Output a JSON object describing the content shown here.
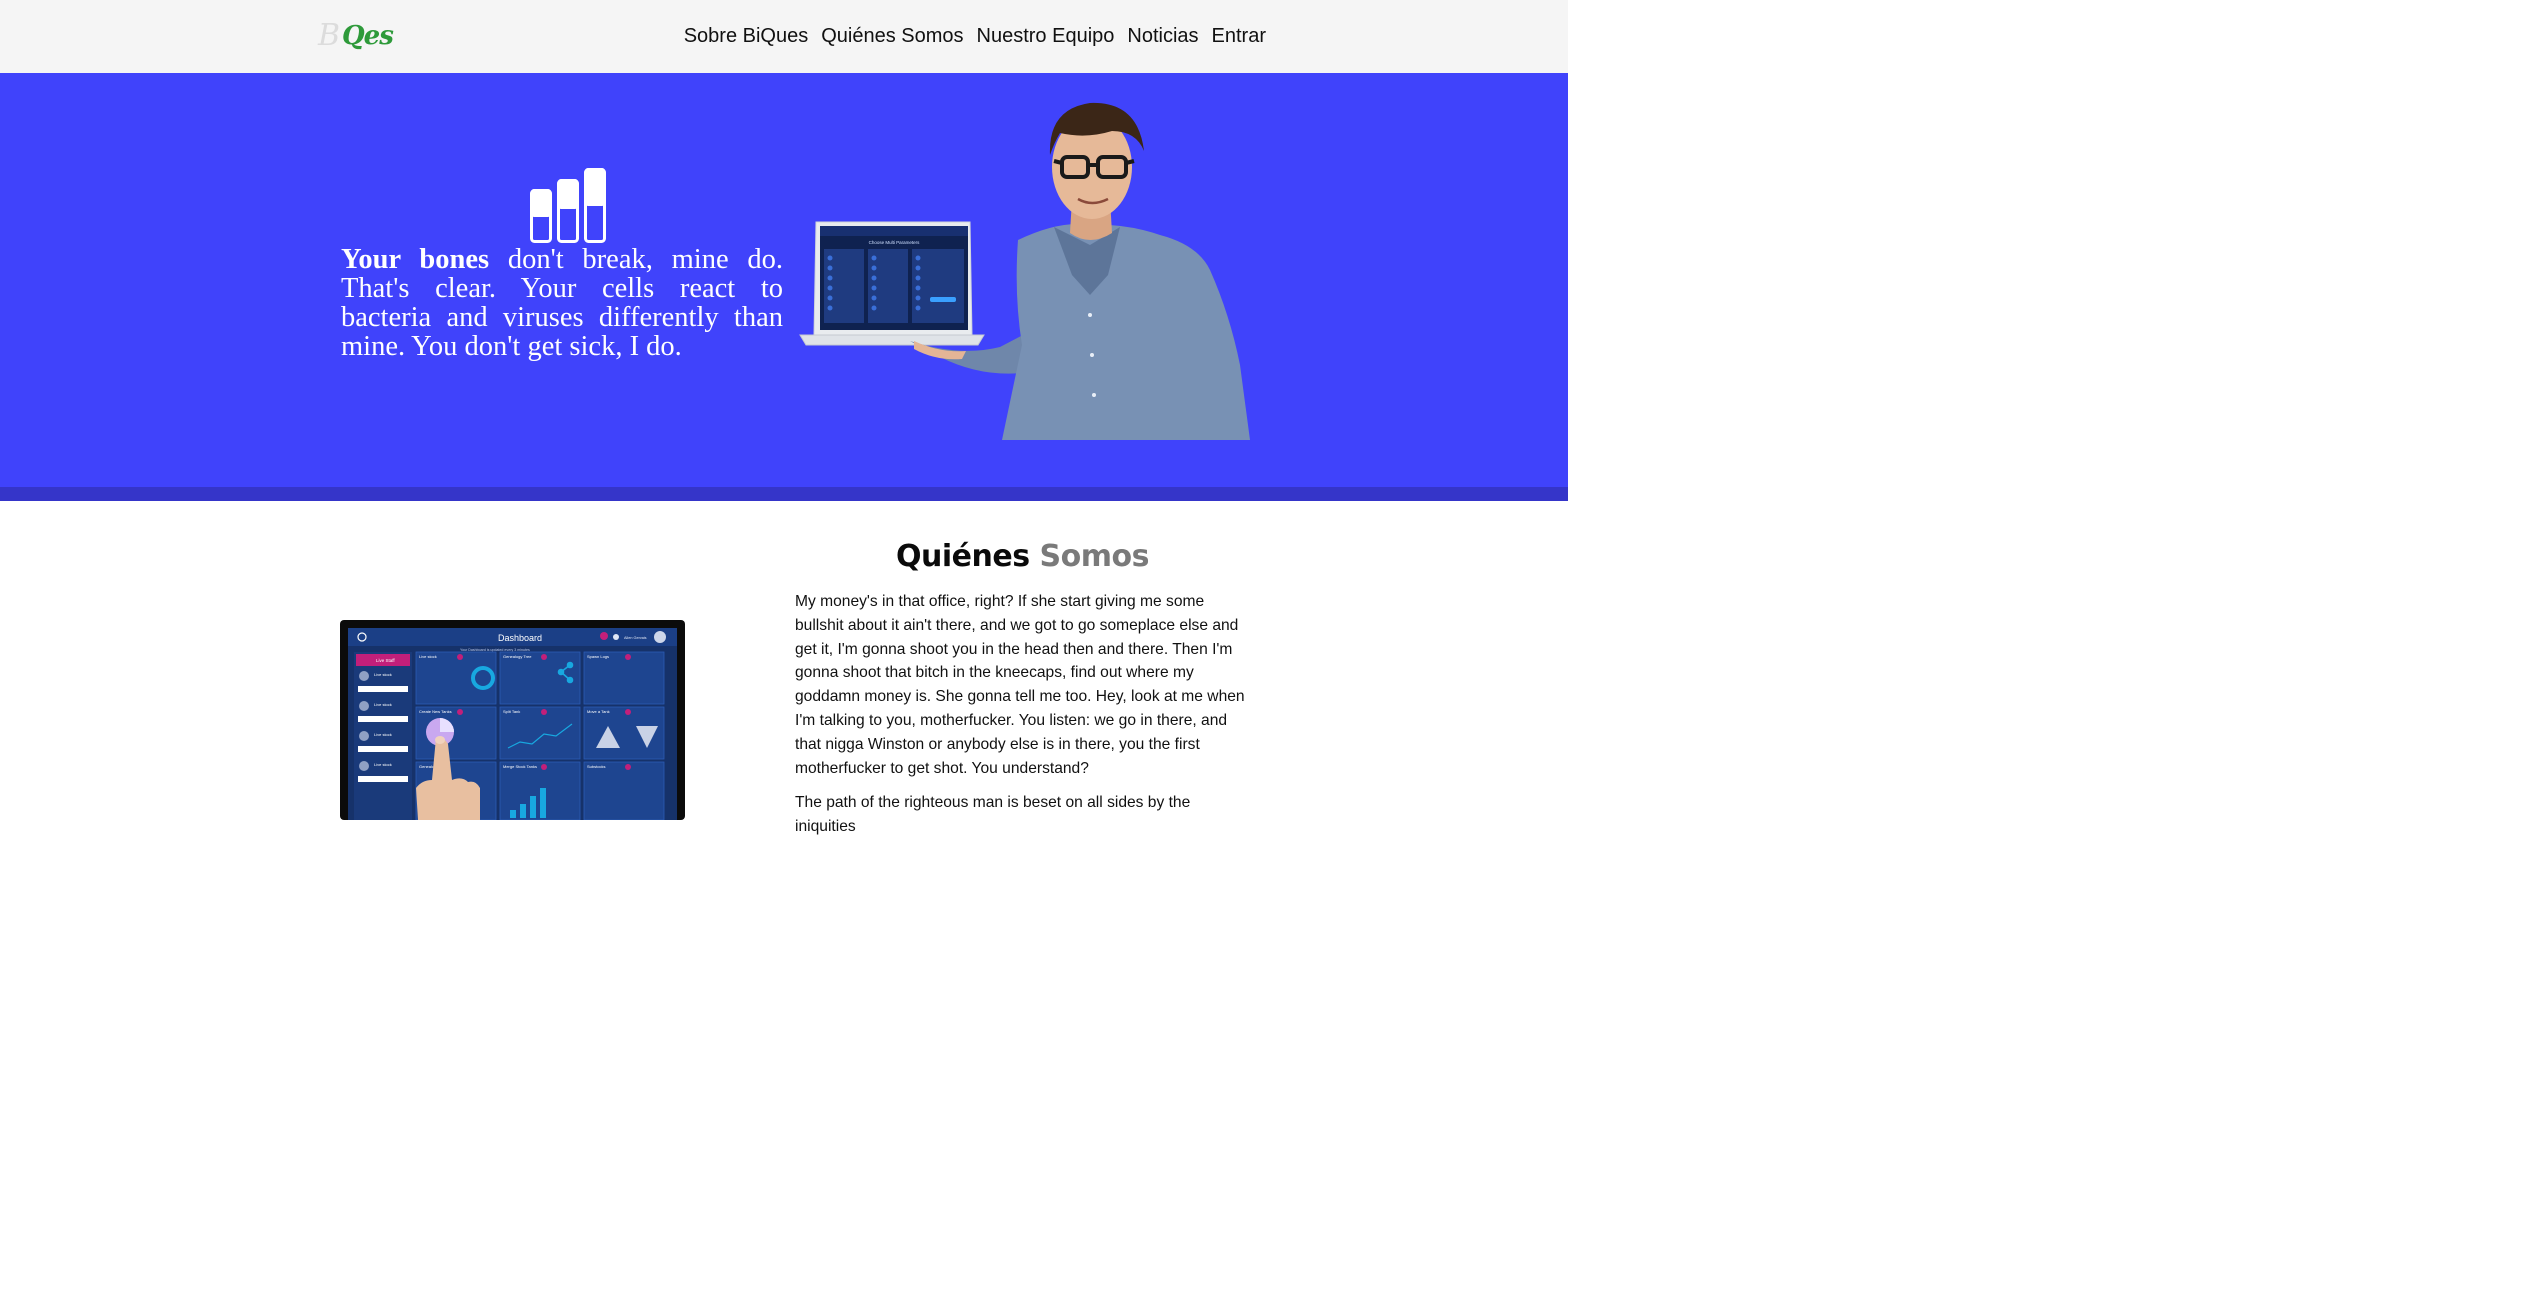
{
  "brand": {
    "logo_b": "B",
    "logo_qes": "Qes",
    "logo_green": "#2e9a3a"
  },
  "nav": {
    "items": [
      {
        "label": "Sobre BiQues"
      },
      {
        "label": "Quiénes Somos"
      },
      {
        "label": "Nuestro Equipo"
      },
      {
        "label": "Noticias"
      },
      {
        "label": "Entrar"
      }
    ]
  },
  "hero": {
    "bg_color": "#4043fb",
    "strip_color": "#3535c9",
    "text_bold": "Your bones",
    "text_rest": " don't break, mine do. That's clear. Your cells react to bacteria and viruses differently than mine. You don't get sick, I do.",
    "icon": "bar-chart-icon",
    "laptop_screen": {
      "title": "Choose Multi Parameters"
    }
  },
  "about": {
    "title_dark": "Quiénes",
    "title_light": "Somos",
    "paragraphs": [
      "My money's in that office, right? If she start giving me some bullshit about it ain't there, and we got to go someplace else and get it, I'm gonna shoot you in the head then and there. Then I'm gonna shoot that bitch in the kneecaps, find out where my goddamn money is. She gonna tell me too. Hey, look at me when I'm talking to you, motherfucker. You listen: we go in there, and that nigga Winston or anybody else is in there, you the first motherfucker to get shot. You understand?",
      "The path of the righteous man is beset on all sides by the iniquities"
    ],
    "tablet": {
      "header": "Dashboard",
      "subheader": "Your Dashboard is updated every 3 minutes",
      "user": "Allen Gervais",
      "sidebar_title": "Live Staff",
      "sidebar_items": [
        "Live stock",
        "Live stock",
        "Live stock",
        "Live stock"
      ],
      "tiles": [
        "Live stock",
        "Genealogy Tree",
        "Spawn Logs",
        "Create New Tanks",
        "Split Tank",
        "Move a Tank",
        "Genealogy Tree",
        "Merge Stock Tanks",
        "Substocks"
      ]
    }
  }
}
